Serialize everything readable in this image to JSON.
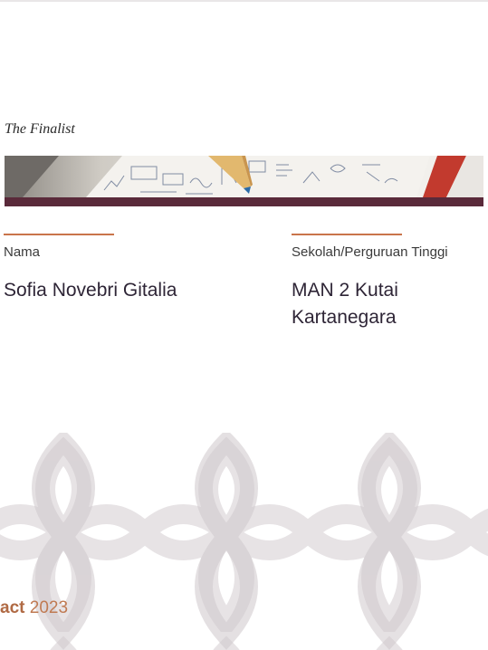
{
  "header": {
    "subtitle": "The Finalist"
  },
  "fields": {
    "name_label": "Nama",
    "name_value": "Sofia Novebri Gitalia",
    "school_label": "Sekolah/Perguruan Tinggi",
    "school_value_line1": "MAN 2 Kutai",
    "school_value_line2": "Kartanegara"
  },
  "footer": {
    "partial_word": "act",
    "year": "2023"
  },
  "colors": {
    "accent_rule": "#c9744a",
    "banner_bar": "#5a2a3a",
    "text_dark": "#2e2536",
    "footer_text": "#b06a44"
  },
  "banner": {
    "image_description_icon": "desk-paper-pencil-photo"
  }
}
